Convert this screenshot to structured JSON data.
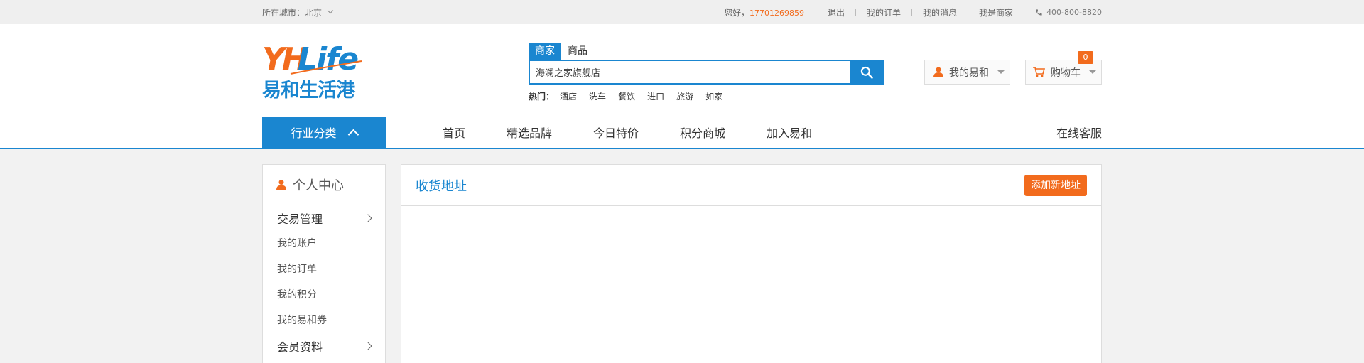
{
  "topbar": {
    "city_label": "所在城市：北京",
    "greeting": "您好，",
    "phone_user": "17701269859",
    "logout": "退出",
    "my_orders": "我的订单",
    "my_messages": "我的消息",
    "i_am_merchant": "我是商家",
    "hotline": "400-800-8820"
  },
  "logo": {
    "text_en": "YHLife",
    "text_cn": "易和生活港"
  },
  "search": {
    "tabs": [
      "商家",
      "商品"
    ],
    "active_tab": "商家",
    "value": "海澜之家旗舰店",
    "hot_label": "热门：",
    "hot_keywords": [
      "酒店",
      "洗车",
      "餐饮",
      "进口",
      "旅游",
      "如家"
    ]
  },
  "user_menu": {
    "label": "我的易和"
  },
  "cart": {
    "label": "购物车",
    "count": "0"
  },
  "nav": {
    "category": "行业分类",
    "links": [
      "首页",
      "精选品牌",
      "今日特价",
      "积分商城",
      "加入易和"
    ],
    "service": "在线客服"
  },
  "sidebar": {
    "title": "个人中心",
    "group1": "交易管理",
    "items": [
      "我的账户",
      "我的订单",
      "我的积分",
      "我的易和券"
    ],
    "group2": "会员资料"
  },
  "content": {
    "title": "收货地址",
    "add_button": "添加新地址"
  },
  "colors": {
    "brand_blue": "#1a86d0",
    "accent_orange": "#f26b1d"
  }
}
